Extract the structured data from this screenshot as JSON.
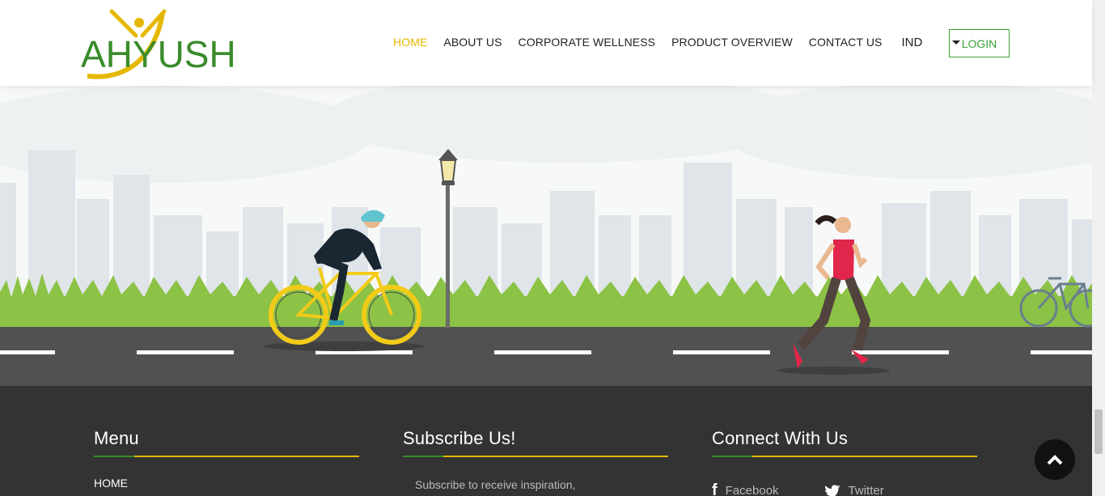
{
  "brand": {
    "name": "AHYUSH",
    "color_green": "#3a8c2b",
    "color_yellow": "#e5b800"
  },
  "nav": {
    "items": [
      {
        "label": "HOME",
        "active": true
      },
      {
        "label": "ABOUT US",
        "active": false
      },
      {
        "label": "CORPORATE WELLNESS",
        "active": false
      },
      {
        "label": "PRODUCT OVERVIEW",
        "active": false
      },
      {
        "label": "CONTACT US",
        "active": false
      }
    ],
    "language": "IND",
    "login_label": "LOGIN"
  },
  "hero": {
    "scene": "city-skyline, grass, road, cyclist, street-lamp, runner, parked-bicycle"
  },
  "footer": {
    "menu": {
      "title": "Menu",
      "items": [
        "HOME"
      ]
    },
    "subscribe": {
      "title": "Subscribe Us!",
      "text": "Subscribe to receive inspiration,"
    },
    "connect": {
      "title": "Connect With Us",
      "links": [
        {
          "label": "Facebook",
          "icon": "facebook-icon"
        },
        {
          "label": "Twitter",
          "icon": "twitter-icon"
        }
      ]
    }
  },
  "icons": {
    "to_top": "chevron-up-icon",
    "language_dropdown": "caret-down-icon"
  }
}
